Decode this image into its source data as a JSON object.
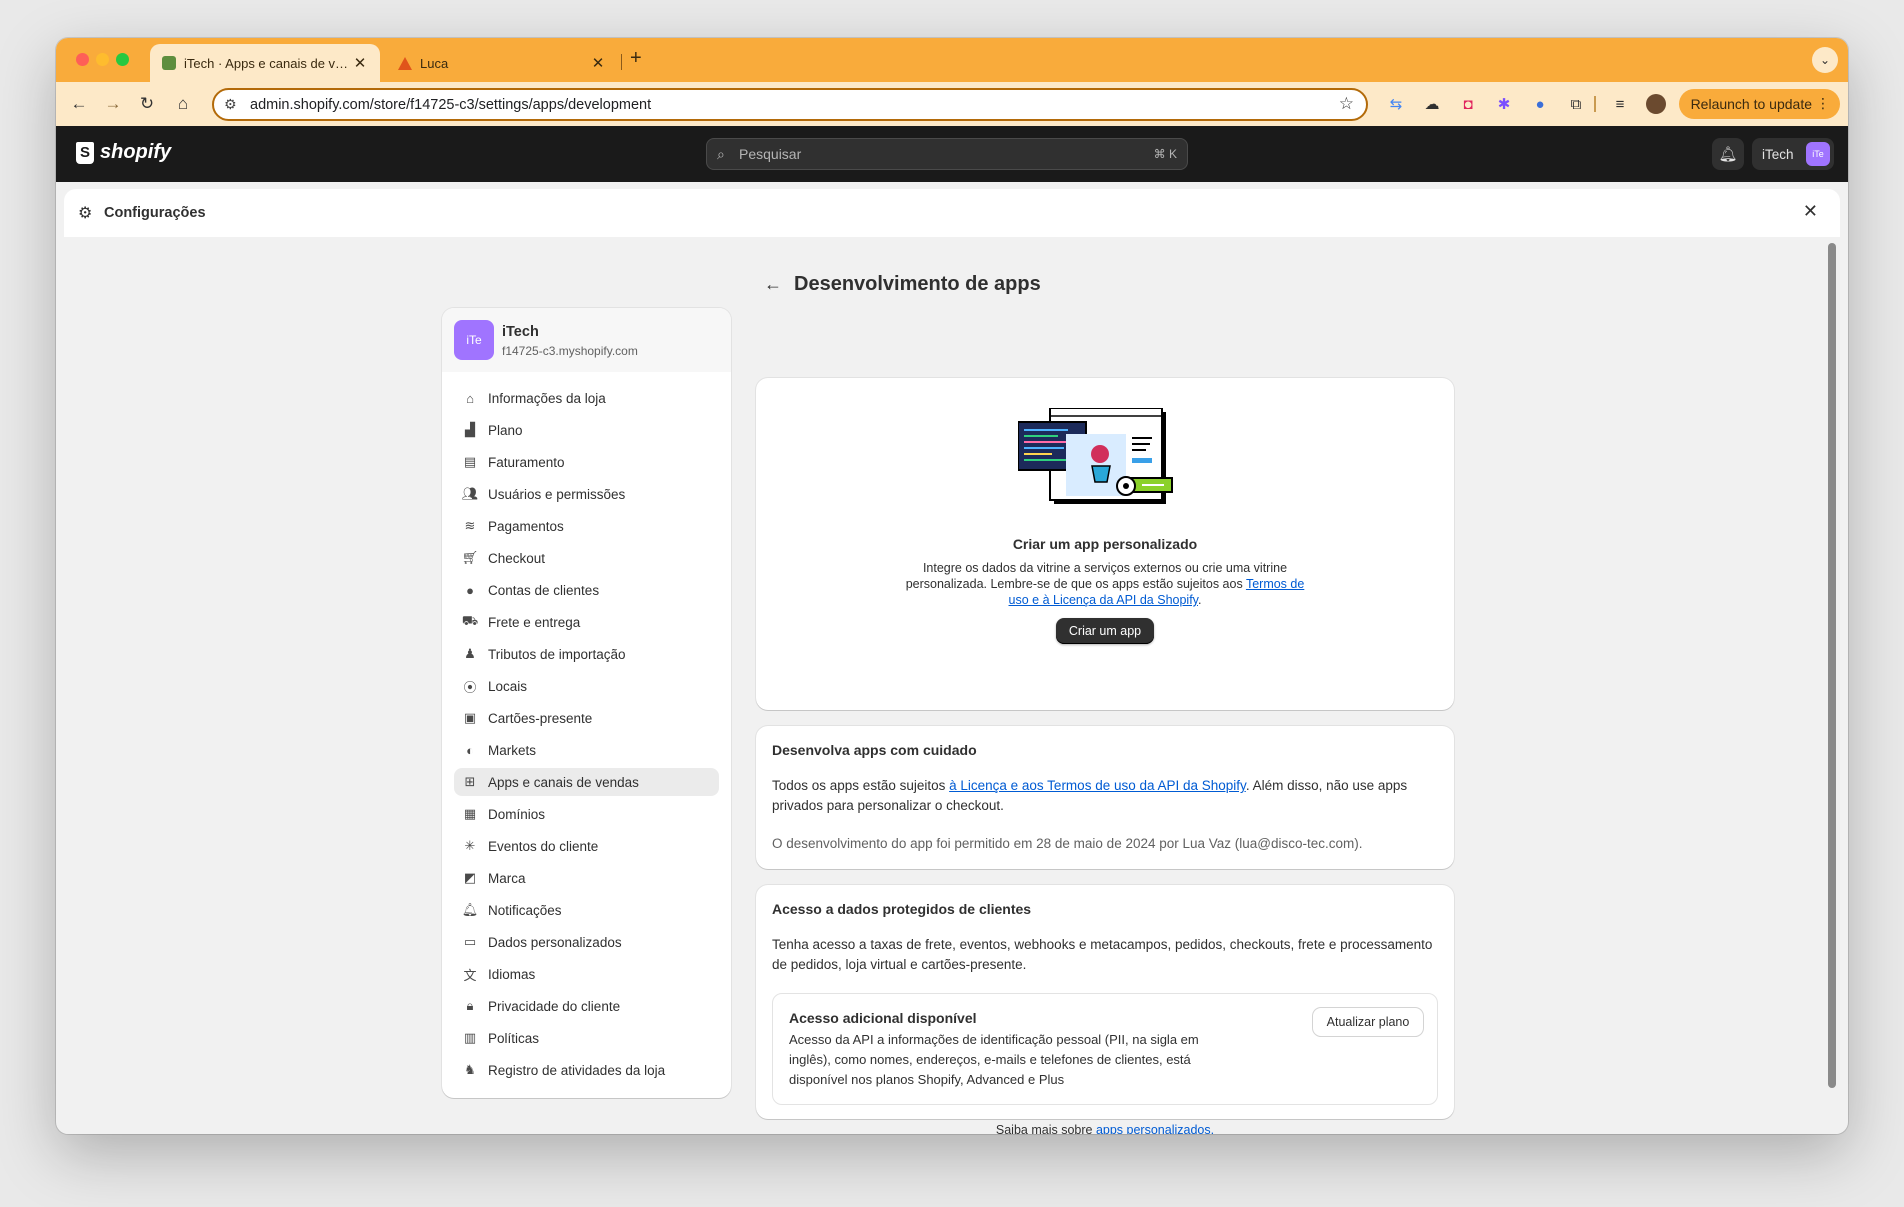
{
  "browser": {
    "tabs": [
      {
        "title": "iTech · Apps e canais de vendas",
        "active": true
      },
      {
        "title": "Luca",
        "active": false
      }
    ],
    "url": "admin.shopify.com/store/f14725-c3/settings/apps/development",
    "relaunch_label": "Relaunch to update"
  },
  "shopify_bar": {
    "logo_text": "shopify",
    "search_placeholder": "Pesquisar",
    "search_shortcut": "⌘ K",
    "store_button": "iTech",
    "avatar_initials": "iTe"
  },
  "settings": {
    "header_title": "Configurações",
    "store": {
      "name": "iTech",
      "domain": "f14725-c3.myshopify.com",
      "initials": "iTe"
    },
    "nav": [
      {
        "label": "Informações da loja",
        "icon": "store-icon"
      },
      {
        "label": "Plano",
        "icon": "plan-chart-icon"
      },
      {
        "label": "Faturamento",
        "icon": "billing-receipt-icon"
      },
      {
        "label": "Usuários e permissões",
        "icon": "users-icon"
      },
      {
        "label": "Pagamentos",
        "icon": "payments-icon"
      },
      {
        "label": "Checkout",
        "icon": "cart-icon"
      },
      {
        "label": "Contas de clientes",
        "icon": "person-icon"
      },
      {
        "label": "Frete e entrega",
        "icon": "truck-icon"
      },
      {
        "label": "Tributos de importação",
        "icon": "tax-icon"
      },
      {
        "label": "Locais",
        "icon": "location-pin-icon"
      },
      {
        "label": "Cartões-presente",
        "icon": "gift-card-icon"
      },
      {
        "label": "Markets",
        "icon": "globe-icon"
      },
      {
        "label": "Apps e canais de vendas",
        "icon": "apps-icon",
        "active": true
      },
      {
        "label": "Domínios",
        "icon": "domain-icon"
      },
      {
        "label": "Eventos do cliente",
        "icon": "cursor-click-icon"
      },
      {
        "label": "Marca",
        "icon": "brand-icon"
      },
      {
        "label": "Notificações",
        "icon": "bell-icon"
      },
      {
        "label": "Dados personalizados",
        "icon": "database-icon"
      },
      {
        "label": "Idiomas",
        "icon": "language-icon"
      },
      {
        "label": "Privacidade do cliente",
        "icon": "lock-icon"
      },
      {
        "label": "Políticas",
        "icon": "policy-icon"
      },
      {
        "label": "Registro de atividades da loja",
        "icon": "activity-log-icon"
      }
    ]
  },
  "main": {
    "title": "Desenvolvimento de apps",
    "create_card": {
      "title": "Criar um app personalizado",
      "body_1": "Integre os dados da vitrine a serviços externos ou crie uma vitrine personalizada. Lembre-se de que os apps estão sujeitos aos ",
      "link": "Termos de uso e à Licença da API da Shopify",
      "body_2": ".",
      "button": "Criar um app"
    },
    "careful_card": {
      "title": "Desenvolva apps com cuidado",
      "body_1": "Todos os apps estão sujeitos ",
      "link": "à Licença e aos Termos de uso da API da Shopify",
      "body_2": ". Além disso, não use apps privados para personalizar o checkout.",
      "note": "O desenvolvimento do app foi permitido em 28 de maio de 2024 por Lua Vaz (lua@disco-tec.com)."
    },
    "protected_card": {
      "title": "Acesso a dados protegidos de clientes",
      "body": "Tenha acesso a taxas de frete, eventos, webhooks e metacampos, pedidos, checkouts, frete e processamento de pedidos, loja virtual e cartões-presente.",
      "sub_title": "Acesso adicional disponível",
      "sub_body": "Acesso da API a informações de identificação pessoal (PII, na sigla em inglês), como nomes, endereços, e-mails e telefones de clientes, está disponível nos planos Shopify, Advanced e Plus",
      "button": "Atualizar plano"
    },
    "footer": {
      "text": "Saiba mais sobre ",
      "link": "apps personalizados."
    }
  }
}
